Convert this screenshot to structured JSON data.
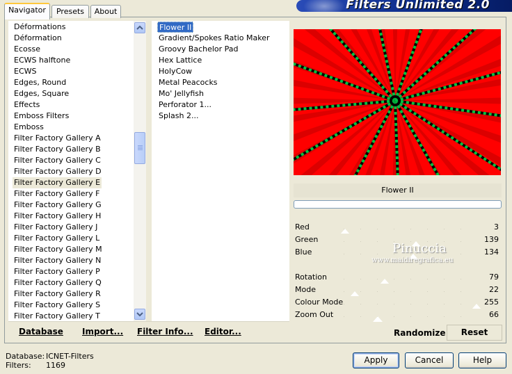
{
  "tabs": [
    {
      "label": "Navigator",
      "active": true
    },
    {
      "label": "Presets",
      "active": false
    },
    {
      "label": "About",
      "active": false
    }
  ],
  "banner": {
    "title": "Filters Unlimited 2.0"
  },
  "categories": {
    "items": [
      "Déformations",
      "Déformation",
      "Ecosse",
      "ECWS halftone",
      "ECWS",
      "Edges, Round",
      "Edges, Square",
      "Effects",
      "Emboss Filters",
      "Emboss",
      "Filter Factory Gallery A",
      "Filter Factory Gallery B",
      "Filter Factory Gallery C",
      "Filter Factory Gallery D",
      "Filter Factory Gallery E",
      "Filter Factory Gallery F",
      "Filter Factory Gallery G",
      "Filter Factory Gallery H",
      "Filter Factory Gallery J",
      "Filter Factory Gallery L",
      "Filter Factory Gallery M",
      "Filter Factory Gallery N",
      "Filter Factory Gallery P",
      "Filter Factory Gallery Q",
      "Filter Factory Gallery R",
      "Filter Factory Gallery S",
      "Filter Factory Gallery T"
    ],
    "selected": "Filter Factory Gallery E"
  },
  "filters": {
    "items": [
      "Flower II",
      "Gradient/Spokes Ratio Maker",
      "Groovy Bachelor Pad",
      "Hex Lattice",
      "HolyCow",
      "Metal Peacocks",
      "Mo' Jellyfish",
      "Perforator 1...",
      "Splash 2..."
    ],
    "selected": "Flower II"
  },
  "link_buttons": {
    "database": "Database",
    "import": "Import...",
    "filter_info": "Filter Info...",
    "editor": "Editor..."
  },
  "preview": {
    "filter_name": "Flower II",
    "progress": 0
  },
  "watermark": {
    "name": "Pinuccia",
    "site": "www.maidiregrafica.eu"
  },
  "sliders": [
    {
      "label": "Red",
      "value": "3",
      "max": 255
    },
    {
      "label": "Green",
      "value": "139",
      "max": 255
    },
    {
      "label": "Blue",
      "value": "134",
      "max": 255
    },
    {
      "label": "Rotation",
      "value": "79",
      "max": 255
    },
    {
      "label": "Mode",
      "value": "22",
      "max": 255
    },
    {
      "label": "Colour Mode",
      "value": "255",
      "max": 255
    },
    {
      "label": "Zoom Out",
      "value": "66",
      "max": 255
    }
  ],
  "actions": {
    "randomize": "Randomize",
    "reset": "Reset"
  },
  "footer": {
    "database_label": "Database:",
    "database_value": "ICNET-Filters",
    "filters_label": "Filters:",
    "filters_value": "1169"
  },
  "dialog_buttons": {
    "apply": "Apply",
    "cancel": "Cancel",
    "help": "Help"
  },
  "colors": {
    "preview_bg": "#ff0000",
    "spoke_green": "#00c040",
    "selection_blue": "#316ac5",
    "banner_blue": "#0a2a86"
  }
}
